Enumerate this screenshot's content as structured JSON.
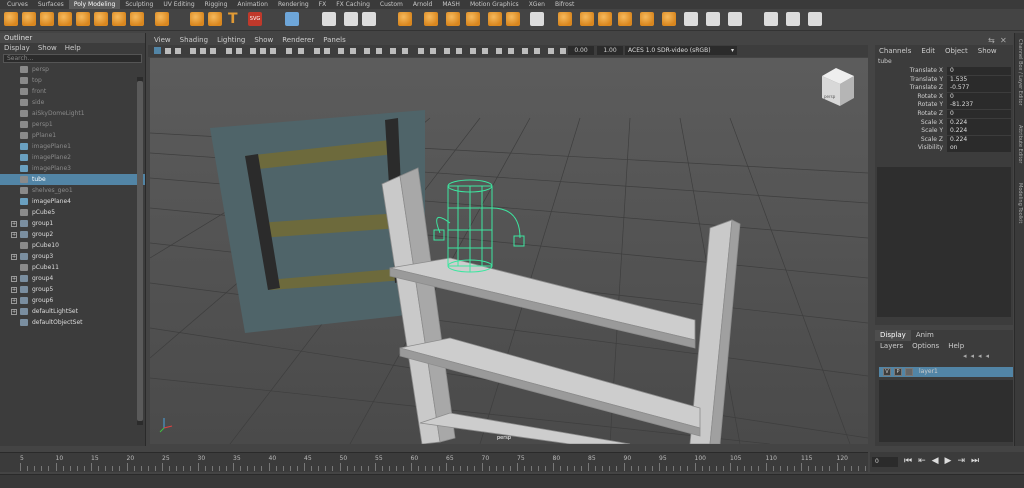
{
  "shelf_tabs": [
    "Curves",
    "Surfaces",
    "Poly Modeling",
    "Sculpting",
    "UV Editing",
    "Rigging",
    "Animation",
    "Rendering",
    "FX",
    "FX Caching",
    "Custom",
    "Arnold",
    "MASH",
    "Motion Graphics",
    "XGen",
    "Bifrost"
  ],
  "shelf_active_tab": "Poly Modeling",
  "outliner": {
    "title": "Outliner",
    "menu": [
      "Display",
      "Show",
      "Help"
    ],
    "search_placeholder": "Search...",
    "items": [
      {
        "label": "persp",
        "dim": true,
        "icon": "camera-icon"
      },
      {
        "label": "top",
        "dim": true,
        "icon": "camera-icon"
      },
      {
        "label": "front",
        "dim": true,
        "icon": "camera-icon"
      },
      {
        "label": "side",
        "dim": true,
        "icon": "camera-icon"
      },
      {
        "label": "aiSkyDomeLight1",
        "dim": true,
        "icon": "light-icon"
      },
      {
        "label": "persp1",
        "dim": true,
        "icon": "camera-icon"
      },
      {
        "label": "pPlane1",
        "dim": true,
        "icon": "mesh-icon"
      },
      {
        "label": "imagePlane1",
        "dim": true,
        "icon": "image-plane-icon"
      },
      {
        "label": "imagePlane2",
        "dim": true,
        "icon": "image-plane-icon"
      },
      {
        "label": "imagePlane3",
        "dim": true,
        "icon": "image-plane-icon"
      },
      {
        "label": "tube",
        "selected": true,
        "icon": "mesh-icon"
      },
      {
        "label": "shelves_geo1",
        "dim": true,
        "icon": "mesh-icon"
      },
      {
        "label": "imagePlane4",
        "icon": "image-plane-icon"
      },
      {
        "label": "pCube5",
        "icon": "mesh-icon"
      },
      {
        "label": "group1",
        "expand": true,
        "icon": "group-icon"
      },
      {
        "label": "group2",
        "expand": true,
        "icon": "group-icon"
      },
      {
        "label": "pCube10",
        "icon": "mesh-icon"
      },
      {
        "label": "group3",
        "expand": true,
        "icon": "group-icon"
      },
      {
        "label": "pCube11",
        "icon": "mesh-icon"
      },
      {
        "label": "group4",
        "expand": true,
        "icon": "group-icon"
      },
      {
        "label": "group5",
        "expand": true,
        "icon": "group-icon"
      },
      {
        "label": "group6",
        "expand": true,
        "icon": "group-icon"
      },
      {
        "label": "defaultLightSet",
        "expand": true,
        "icon": "set-icon"
      },
      {
        "label": "defaultObjectSet",
        "icon": "set-icon"
      }
    ]
  },
  "viewport": {
    "menu": [
      "View",
      "Shading",
      "Lighting",
      "Show",
      "Renderer",
      "Panels"
    ],
    "field_a": "0.00",
    "field_b": "1.00",
    "color_space": "ACES 1.0 SDR-video (sRGB)",
    "camera_label": "persp",
    "viewcube_label": "persp"
  },
  "channel_box": {
    "menu": [
      "Channels",
      "Edit",
      "Object",
      "Show"
    ],
    "object_name": "tube",
    "rows": [
      {
        "label": "Translate X",
        "value": "0"
      },
      {
        "label": "Translate Y",
        "value": "1.535"
      },
      {
        "label": "Translate Z",
        "value": "-0.577"
      },
      {
        "label": "Rotate X",
        "value": "0"
      },
      {
        "label": "Rotate Y",
        "value": "-81.237"
      },
      {
        "label": "Rotate Z",
        "value": "0"
      },
      {
        "label": "Scale X",
        "value": "0.224"
      },
      {
        "label": "Scale Y",
        "value": "0.224"
      },
      {
        "label": "Scale Z",
        "value": "0.224"
      },
      {
        "label": "Visibility",
        "value": "on"
      }
    ]
  },
  "side_tabs": [
    "Channel Box / Layer Editor",
    "Attribute Editor",
    "Modeling Toolkit"
  ],
  "layer_editor": {
    "tabs": [
      "Display",
      "Anim"
    ],
    "menu": [
      "Layers",
      "Options",
      "Help"
    ],
    "layer": {
      "name": "layer1",
      "v": "V",
      "p": "P"
    }
  },
  "timeline": {
    "ticks": [
      "5",
      "10",
      "15",
      "20",
      "25",
      "30",
      "35",
      "40",
      "45",
      "50",
      "55",
      "60",
      "65",
      "70",
      "75",
      "80",
      "85",
      "90",
      "95",
      "100",
      "105",
      "110",
      "115",
      "120"
    ],
    "current_frame": "0"
  },
  "colors": {
    "selection": "#5285a6",
    "accent_orange": "#e09a35",
    "wireframe": "#3de6a0"
  }
}
